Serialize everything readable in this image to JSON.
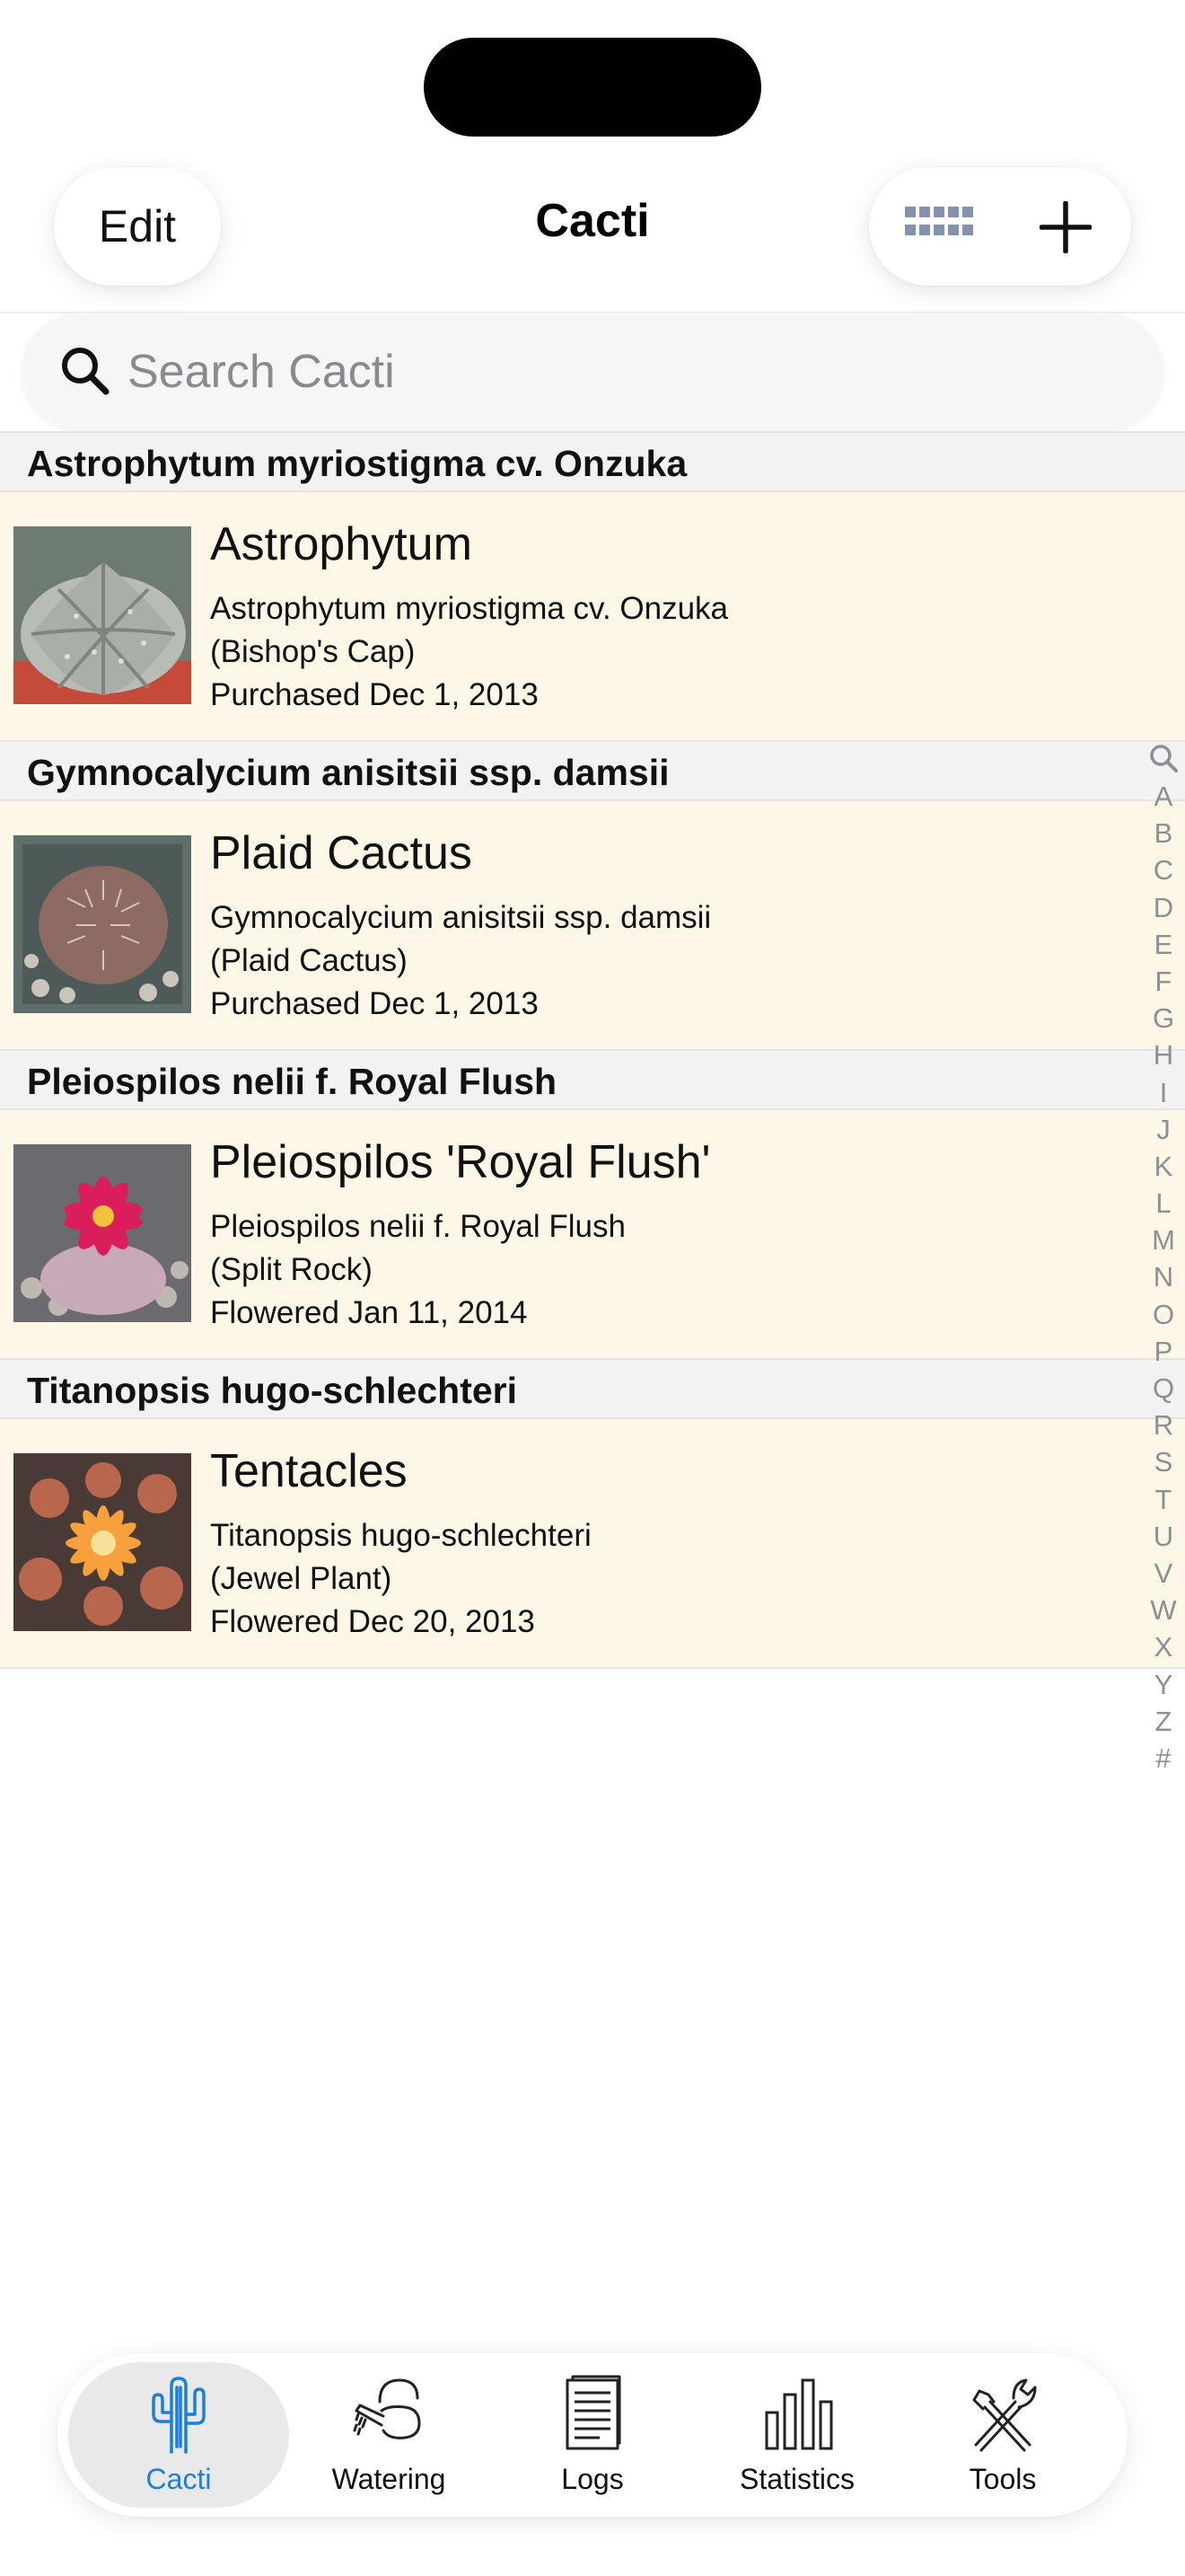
{
  "nav": {
    "edit_label": "Edit",
    "title": "Cacti"
  },
  "search": {
    "placeholder": "Search Cacti"
  },
  "sections": [
    {
      "header": "Astrophytum myriostigma cv. Onzuka",
      "item": {
        "name": "Astrophytum",
        "species": "Astrophytum myriostigma cv. Onzuka",
        "common": "(Bishop's Cap)",
        "event": "Purchased Dec 1, 2013",
        "photo": "cactus-photo"
      }
    },
    {
      "header": "Gymnocalycium anisitsii ssp. damsii",
      "item": {
        "name": "Plaid Cactus",
        "species": "Gymnocalycium anisitsii ssp. damsii",
        "common": "(Plaid Cactus)",
        "event": "Purchased Dec 1, 2013",
        "photo": "cactus-photo"
      }
    },
    {
      "header": "Pleiospilos nelii f. Royal Flush",
      "item": {
        "name": "Pleiospilos 'Royal Flush'",
        "species": "Pleiospilos nelii f. Royal Flush",
        "common": "(Split Rock)",
        "event": "Flowered Jan 11, 2014",
        "photo": "succulent-flower-photo"
      }
    },
    {
      "header": "Titanopsis hugo-schlechteri",
      "item": {
        "name": "Tentacles",
        "species": "Titanopsis hugo-schlechteri",
        "common": "(Jewel Plant)",
        "event": "Flowered Dec 20, 2013",
        "photo": "succulent-flower-photo"
      }
    }
  ],
  "index": {
    "letters": [
      "A",
      "B",
      "C",
      "D",
      "E",
      "F",
      "G",
      "H",
      "I",
      "J",
      "K",
      "L",
      "M",
      "N",
      "O",
      "P",
      "Q",
      "R",
      "S",
      "T",
      "U",
      "V",
      "W",
      "X",
      "Y",
      "Z",
      "#"
    ]
  },
  "tabs": [
    {
      "label": "Cacti",
      "icon": "cactus-icon",
      "active": true
    },
    {
      "label": "Watering",
      "icon": "watering-can-icon",
      "active": false
    },
    {
      "label": "Logs",
      "icon": "document-icon",
      "active": false
    },
    {
      "label": "Statistics",
      "icon": "bar-chart-icon",
      "active": false
    },
    {
      "label": "Tools",
      "icon": "tools-icon",
      "active": false
    }
  ],
  "colors": {
    "accent": "#1a7fe0",
    "row_background": "#fdf7e8",
    "section_background": "#f2f2f2",
    "index_letters": "#8e8e93"
  }
}
